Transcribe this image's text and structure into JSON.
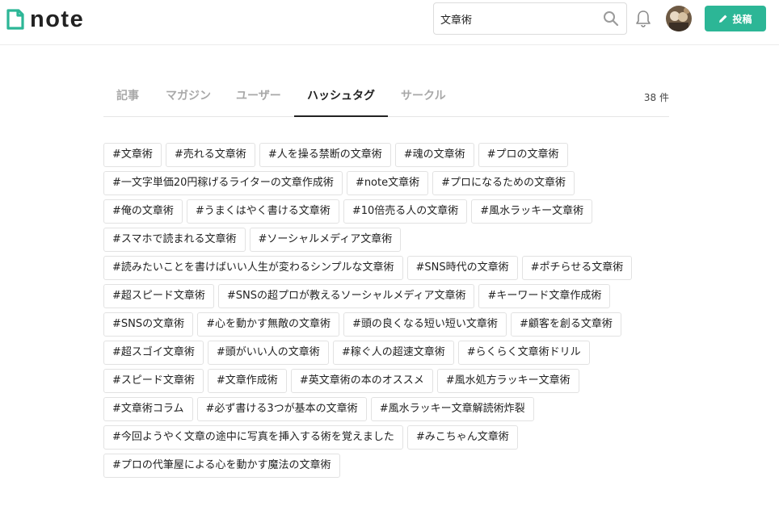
{
  "header": {
    "logo_text": "note",
    "search": {
      "value": "文章術",
      "placeholder": ""
    },
    "post_label": "投稿",
    "brand_color": "#2cb696"
  },
  "tabs": [
    {
      "label": "記事",
      "active": false
    },
    {
      "label": "マガジン",
      "active": false
    },
    {
      "label": "ユーザー",
      "active": false
    },
    {
      "label": "ハッシュタグ",
      "active": true
    },
    {
      "label": "サークル",
      "active": false
    }
  ],
  "result_count": "38 件",
  "tag_rows": [
    [
      "#文章術",
      "#売れる文章術",
      "#人を操る禁断の文章術",
      "#魂の文章術",
      "#プロの文章術"
    ],
    [
      "#一文字単価20円稼げるライターの文章作成術",
      "#note文章術",
      "#プロになるための文章術"
    ],
    [
      "#俺の文章術",
      "#うまくはやく書ける文章術",
      "#10倍売る人の文章術",
      "#風水ラッキー文章術"
    ],
    [
      "#スマホで読まれる文章術",
      "#ソーシャルメディア文章術"
    ],
    [
      "#読みたいことを書けばいい人生が変わるシンプルな文章術",
      "#SNS時代の文章術",
      "#ポチらせる文章術"
    ],
    [
      "#超スピード文章術",
      "#SNSの超プロが教えるソーシャルメディア文章術",
      "#キーワード文章作成術"
    ],
    [
      "#SNSの文章術",
      "#心を動かす無敵の文章術",
      "#頭の良くなる短い短い文章術",
      "#顧客を創る文章術"
    ],
    [
      "#超スゴイ文章術",
      "#頭がいい人の文章術",
      "#稼ぐ人の超速文章術",
      "#らくらく文章術ドリル"
    ],
    [
      "#スピード文章術",
      "#文章作成術",
      "#英文章術の本のオススメ",
      "#風水処方ラッキー文章術"
    ],
    [
      "#文章術コラム",
      "#必ず書ける3つが基本の文章術",
      "#風水ラッキー文章解読術炸裂"
    ],
    [
      "#今回ようやく文章の途中に写真を挿入する術を覚えました",
      "#みこちゃん文章術"
    ],
    [
      "#プロの代筆屋による心を動かす魔法の文章術"
    ]
  ]
}
